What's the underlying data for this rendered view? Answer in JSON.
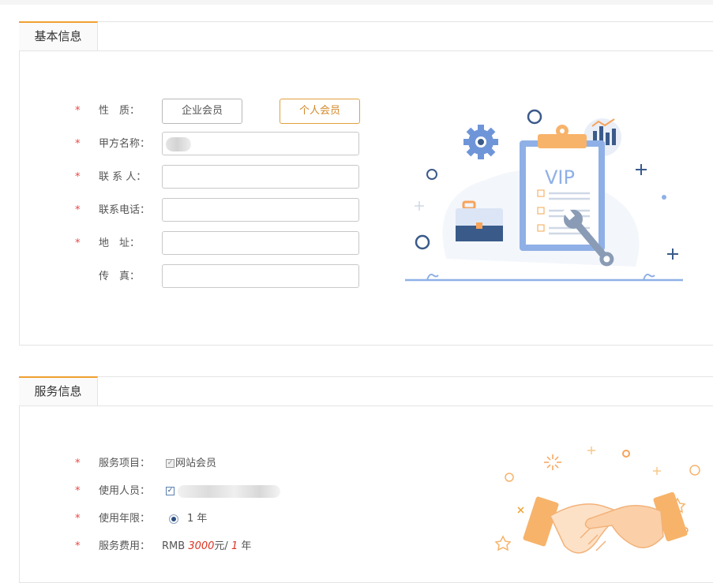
{
  "basic": {
    "tab": "基本信息",
    "fields": {
      "nature": {
        "label": "性　质：",
        "options": [
          "企业会员",
          "个人会员"
        ],
        "selected": "个人会员"
      },
      "party_name": {
        "label": "甲方名称：",
        "value": ""
      },
      "contact": {
        "label": "联 系 人：",
        "value": ""
      },
      "phone": {
        "label": "联系电话：",
        "value": ""
      },
      "address": {
        "label": "地　址：",
        "value": ""
      },
      "fax": {
        "label": "传　真：",
        "value": ""
      }
    },
    "illustration": {
      "badge_text": "VIP"
    }
  },
  "service": {
    "tab": "服务信息",
    "project_label": "服务项目：",
    "project_value": "网站会员",
    "user_label": "使用人员：",
    "years_label": "使用年限：",
    "years_option": "1 年",
    "fee_label": "服务费用：",
    "fee_prefix": "RMB",
    "fee_amount": "3000",
    "fee_unit": "元/",
    "fee_years": "1",
    "fee_suffix": "年"
  },
  "colors": {
    "accent": "#f0a030",
    "required": "#e44444",
    "illus_blue": "#8fb0e6",
    "illus_orange": "#f7b36a"
  }
}
